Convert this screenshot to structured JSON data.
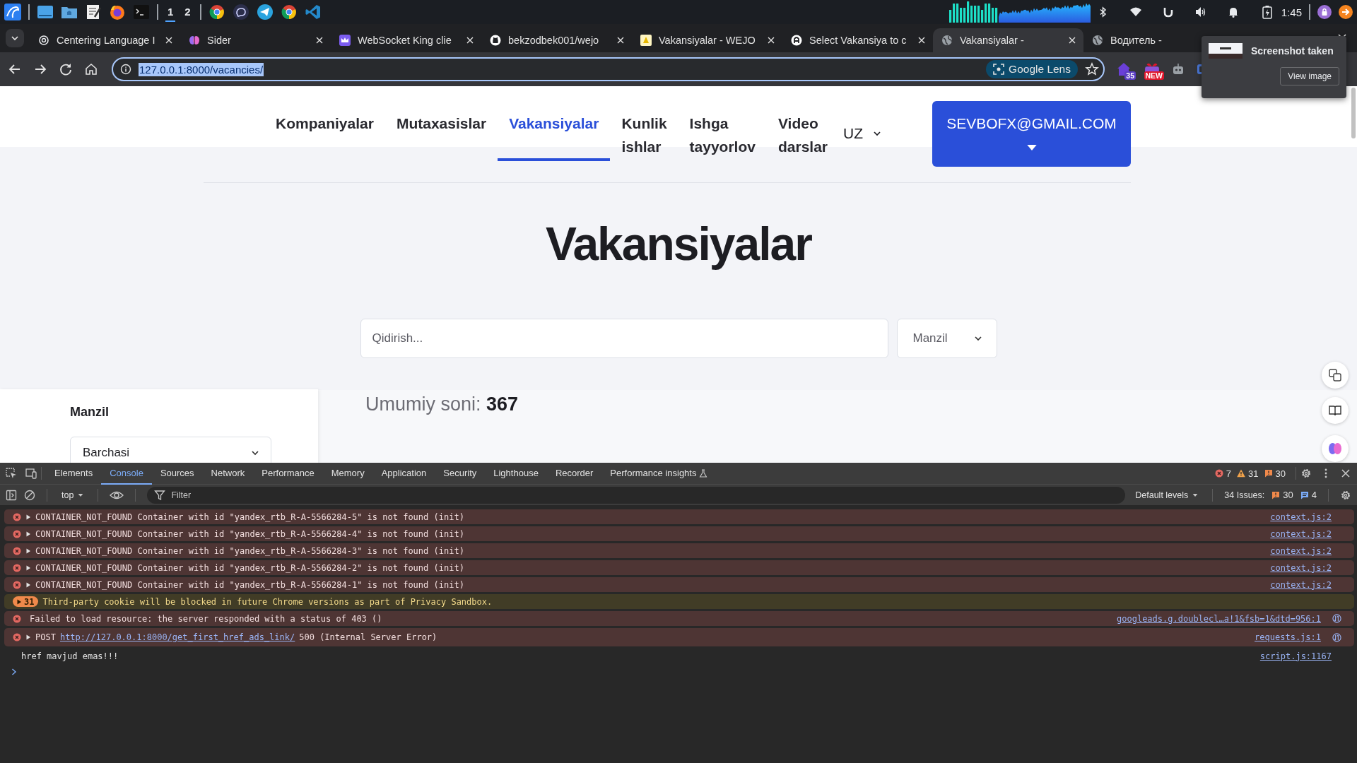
{
  "taskbar": {
    "workspaces": [
      {
        "label": "1",
        "selected": true
      },
      {
        "label": "2",
        "selected": false
      }
    ],
    "clock": "1:45"
  },
  "browser": {
    "tabs": [
      {
        "title": "Centering Language I",
        "selected": false
      },
      {
        "title": "Sider",
        "selected": false
      },
      {
        "title": "WebSocket King clie",
        "selected": false
      },
      {
        "title": "bekzodbek001/wejo",
        "selected": false
      },
      {
        "title": "Vakansiyalar - WEJO",
        "selected": false
      },
      {
        "title": "Select Vakansiya to c",
        "selected": false
      },
      {
        "title": "Vakansiyalar -",
        "selected": true
      },
      {
        "title": "Водитель -",
        "selected": false
      }
    ],
    "address": "127.0.0.1:8000/vacancies/",
    "lens": "Google Lens",
    "extension_badges": [
      {
        "text": "35",
        "kind": "count"
      },
      {
        "text": "NEW",
        "kind": "new"
      }
    ]
  },
  "notification": {
    "title": "Screenshot taken",
    "button": "View image"
  },
  "page": {
    "nav": [
      {
        "label": "Kompaniyalar",
        "selected": false
      },
      {
        "label": "Mutaxasislar",
        "selected": false
      },
      {
        "label": "Vakansiyalar",
        "selected": true
      },
      {
        "label": "Kunlik ishlar",
        "selected": false
      },
      {
        "label": "Ishga tayyorlov",
        "selected": false
      },
      {
        "label": "Video darslar",
        "selected": false
      }
    ],
    "language": "UZ",
    "user_button": "SEVBOFX@GMAIL.COM",
    "title": "Vakansiyalar",
    "search": {
      "placeholder": "Qidirish..."
    },
    "location_select": "Manzil",
    "sidebar": {
      "heading": "Manzil",
      "select": "Barchasi"
    },
    "total": "Umumiy soni: **367**"
  },
  "devtools": {
    "tabs": [
      {
        "label": "Elements",
        "selected": false
      },
      {
        "label": "Console",
        "selected": true
      },
      {
        "label": "Sources",
        "selected": false
      },
      {
        "label": "Network",
        "selected": false
      },
      {
        "label": "Performance",
        "selected": false
      },
      {
        "label": "Memory",
        "selected": false
      },
      {
        "label": "Application",
        "selected": false
      },
      {
        "label": "Security",
        "selected": false
      },
      {
        "label": "Lighthouse",
        "selected": false
      },
      {
        "label": "Recorder",
        "selected": false
      },
      {
        "label": "Performance insights",
        "selected": false
      }
    ],
    "counts": {
      "errors": "7",
      "warnings": "31",
      "issues": "30"
    },
    "context": "top",
    "filter": {
      "placeholder": "Filter"
    },
    "levels": "Default levels",
    "issues": {
      "label": "34 Issues:",
      "warnings": "30",
      "info": "4"
    },
    "messages": [
      {
        "kind": "error",
        "expandable": true,
        "text": "CONTAINER_NOT_FOUND Container with id \"yandex_rtb_R-A-5566284-5\" is not found (init)",
        "source": "context.js:2",
        "network": false
      },
      {
        "kind": "error",
        "expandable": true,
        "text": "CONTAINER_NOT_FOUND Container with id \"yandex_rtb_R-A-5566284-4\" is not found (init)",
        "source": "context.js:2",
        "network": false
      },
      {
        "kind": "error",
        "expandable": true,
        "text": "CONTAINER_NOT_FOUND Container with id \"yandex_rtb_R-A-5566284-3\" is not found (init)",
        "source": "context.js:2",
        "network": false
      },
      {
        "kind": "error",
        "expandable": true,
        "text": "CONTAINER_NOT_FOUND Container with id \"yandex_rtb_R-A-5566284-2\" is not found (init)",
        "source": "context.js:2",
        "network": false
      },
      {
        "kind": "error",
        "expandable": true,
        "text": "CONTAINER_NOT_FOUND Container with id \"yandex_rtb_R-A-5566284-1\" is not found (init)",
        "source": "context.js:2",
        "network": false
      },
      {
        "kind": "warning_group",
        "count": "31",
        "text": "Third-party cookie will be blocked in future Chrome versions as part of Privacy Sandbox."
      },
      {
        "kind": "error",
        "expandable": false,
        "text": "Failed to load resource: the server responded with a status of 403 ()",
        "source": "googleads.g.doublecl…a!1&fsb=1&dtd=956:1",
        "network": true
      },
      {
        "kind": "error",
        "expandable": true,
        "text": "POST",
        "link": "http://127.0.0.1:8000/get_first_href_ads_link/",
        "suffix": "500 (Internal Server Error)",
        "source": "requests.js:1",
        "network": true
      },
      {
        "kind": "log",
        "text": "href mavjud emas!!!",
        "source": "script.js:1167"
      }
    ]
  }
}
